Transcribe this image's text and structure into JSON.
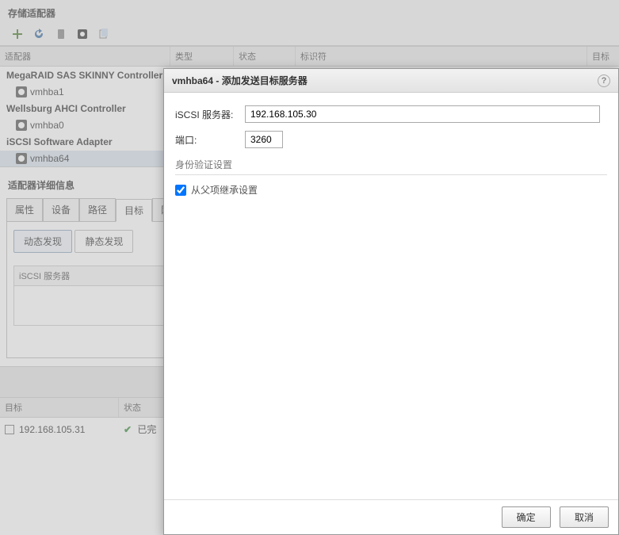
{
  "page_title": "存储适配器",
  "columns": {
    "adapter": "适配器",
    "type": "类型",
    "state": "状态",
    "identifier": "标识符",
    "target": "目标"
  },
  "adapters": {
    "group1": "MegaRAID SAS SKINNY Controller",
    "item1": "vmhba1",
    "group2": "Wellsburg AHCI Controller",
    "item2": "vmhba0",
    "group3": "iSCSI Software Adapter",
    "item3": "vmhba64"
  },
  "details_title": "适配器详细信息",
  "tabs": {
    "properties": "属性",
    "devices": "设备",
    "paths": "路径",
    "targets": "目标",
    "network": "网络"
  },
  "toggle": {
    "dynamic": "动态发现",
    "static": "静态发现"
  },
  "inner_col": "iSCSI 服务器",
  "bottom": {
    "col_target": "目标",
    "col_state": "状态",
    "ip": "192.168.105.31",
    "state_text": "已完"
  },
  "dialog": {
    "title": "vmhba64 - 添加发送目标服务器",
    "label_server": "iSCSI 服务器:",
    "server_value": "192.168.105.30",
    "label_port": "端口:",
    "port_value": "3260",
    "section": "身份验证设置",
    "inherit": "从父项继承设置",
    "ok": "确定",
    "cancel": "取消"
  }
}
